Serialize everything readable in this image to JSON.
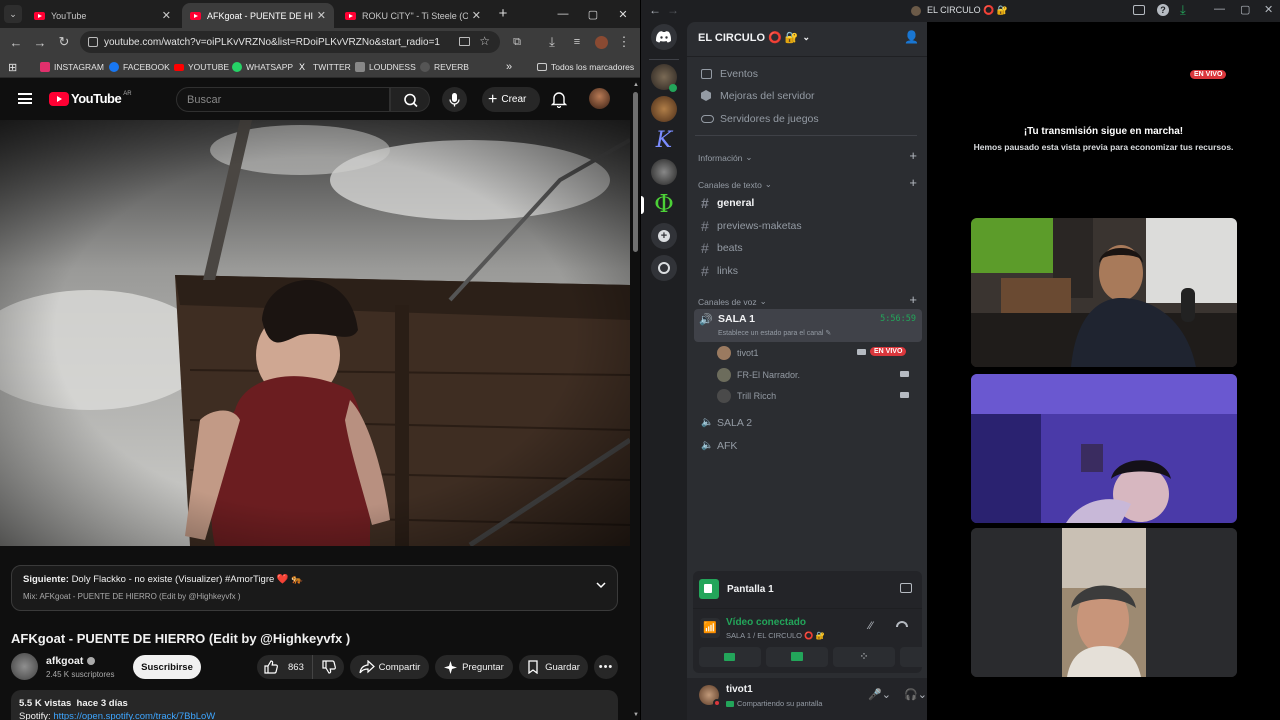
{
  "chrome": {
    "tabs": [
      {
        "title": "YouTube",
        "active": false
      },
      {
        "title": "AFKgoat - PUENTE DE HIERRO",
        "active": true
      },
      {
        "title": "ROKU CiTY\" - Ti Steele (Officia",
        "active": false
      }
    ],
    "url": "youtube.com/watch?v=oiPLKvVRZNo&list=RDoiPLKvVRZNo&start_radio=1",
    "bookmarks": [
      "INSTAGRAM",
      "FACEBOOK",
      "YOUTUBE",
      "WHATSAPP",
      "TWITTER",
      "LOUDNESS",
      "REVERB"
    ],
    "bookmark_colors": [
      "#e1306c",
      "#1877f2",
      "#ff0000",
      "#25d366",
      "#111111",
      "#888888",
      "#555555"
    ],
    "all_bookmarks": "Todos los marcadores"
  },
  "youtube": {
    "logo": "YouTube",
    "region": "AR",
    "search_placeholder": "Buscar",
    "create_label": "Crear",
    "next_label": "Siguiente:",
    "next_title": "Doly Flackko - no existe (Visualizer) #AmorTigre ❤️ 🐅",
    "mix_label": "Mix: AFKgoat - PUENTE DE HIERRO (Edit by @Highkeyvfx )",
    "video_title": "AFKgoat - PUENTE DE HIERRO (Edit by @Highkeyvfx )",
    "channel": "afkgoat",
    "subscribers": "2.45 K suscriptores",
    "subscribe_label": "Suscribirse",
    "likes": "863",
    "share_label": "Compartir",
    "ask_label": "Preguntar",
    "save_label": "Guardar",
    "views_date": "5.5 K vistas  hace 3 días",
    "desc_prefix": "Spotify:",
    "desc_link": "https://open.spotify.com/track/7BbLoW"
  },
  "discord": {
    "window_title": "EL CIRCULO ⭕ 🔐",
    "server_name": "EL CIRCULO ⭕ 🔐",
    "menu": [
      "Eventos",
      "Mejoras del servidor",
      "Servidores de juegos"
    ],
    "categories": {
      "info": "Información",
      "text": "Canales de texto",
      "voice": "Canales de voz"
    },
    "text_channels": [
      "general",
      "previews-maketas",
      "beats",
      "links"
    ],
    "voice": {
      "sala1": "SALA 1",
      "timer": "5:56:59",
      "status_prompt": "Establece un estado para el canal",
      "users": [
        {
          "name": "tivot1",
          "live": "EN VIVO"
        },
        {
          "name": "FR-El Narrador."
        },
        {
          "name": "Trill Ricch"
        }
      ],
      "sala2": "SALA 2",
      "afk": "AFK"
    },
    "screen_panel": {
      "title": "Pantalla 1",
      "connected": "Vídeo conectado",
      "location": "SALA 1 / EL CIRCULO ⭕ 🔐"
    },
    "user": {
      "name": "tivot1",
      "status": "Compartiendo su pantalla"
    },
    "stage": {
      "live": "EN VIVO",
      "message": "¡Tu transmisión sigue en marcha!",
      "sub": "Hemos pausado esta vista previa para economizar tus recursos."
    }
  }
}
